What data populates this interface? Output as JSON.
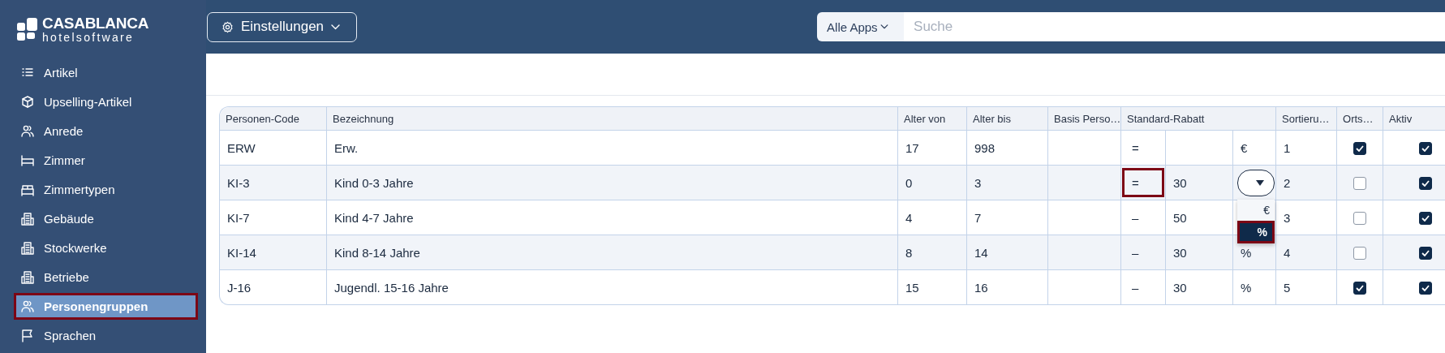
{
  "logo": {
    "name": "CASABLANCA",
    "tagline": "hotelsoftware"
  },
  "sidebar": {
    "items": [
      {
        "label": "Artikel",
        "selected": false
      },
      {
        "label": "Upselling-Artikel",
        "selected": false
      },
      {
        "label": "Anrede",
        "selected": false
      },
      {
        "label": "Zimmer",
        "selected": false
      },
      {
        "label": "Zimmertypen",
        "selected": false
      },
      {
        "label": "Gebäude",
        "selected": false
      },
      {
        "label": "Stockwerke",
        "selected": false
      },
      {
        "label": "Betriebe",
        "selected": false
      },
      {
        "label": "Personengruppen",
        "selected": true
      },
      {
        "label": "Sprachen",
        "selected": false
      }
    ]
  },
  "topbar": {
    "menu_button": "Einstellungen",
    "search": {
      "scope": "Alle Apps",
      "placeholder": "Suche"
    }
  },
  "table": {
    "columns": [
      {
        "label": "Personen-Code"
      },
      {
        "label": "Bezeichnung"
      },
      {
        "label": "Alter von"
      },
      {
        "label": "Alter bis"
      },
      {
        "label": "Basis Perso…"
      },
      {
        "label": "Standard-Rabatt"
      },
      {
        "label": "Sortieru…"
      },
      {
        "label": "Orts…"
      },
      {
        "label": "Aktiv"
      }
    ],
    "rows": [
      {
        "code": "ERW",
        "name": "Erw.",
        "age_from": "17",
        "age_to": "998",
        "operator": "=",
        "operator_highlighted": false,
        "unit": "€",
        "sort": "1",
        "orts": true,
        "aktiv": true
      },
      {
        "code": "KI-3",
        "name": "Kind 0-3 Jahre",
        "age_from": "0",
        "age_to": "3",
        "operator": "=",
        "operator_highlighted": true,
        "discount": "30",
        "unit_dropdown": {
          "open": true,
          "options": [
            {
              "label": "€",
              "selected": false
            },
            {
              "label": "%",
              "selected": true
            }
          ]
        },
        "sort": "2",
        "orts": false,
        "aktiv": true
      },
      {
        "code": "KI-7",
        "name": "Kind 4-7 Jahre",
        "age_from": "4",
        "age_to": "7",
        "operator": "–",
        "operator_highlighted": false,
        "discount": "50",
        "sort": "3",
        "orts": false,
        "aktiv": true
      },
      {
        "code": "KI-14",
        "name": "Kind 8-14 Jahre",
        "age_from": "8",
        "age_to": "14",
        "operator": "–",
        "operator_highlighted": false,
        "discount": "30",
        "unit": "%",
        "sort": "4",
        "orts": false,
        "aktiv": true
      },
      {
        "code": "J-16",
        "name": "Jugendl. 15-16 Jahre",
        "age_from": "15",
        "age_to": "16",
        "operator": "–",
        "operator_highlighted": false,
        "discount": "30",
        "unit": "%",
        "sort": "5",
        "orts": true,
        "aktiv": true
      }
    ]
  }
}
